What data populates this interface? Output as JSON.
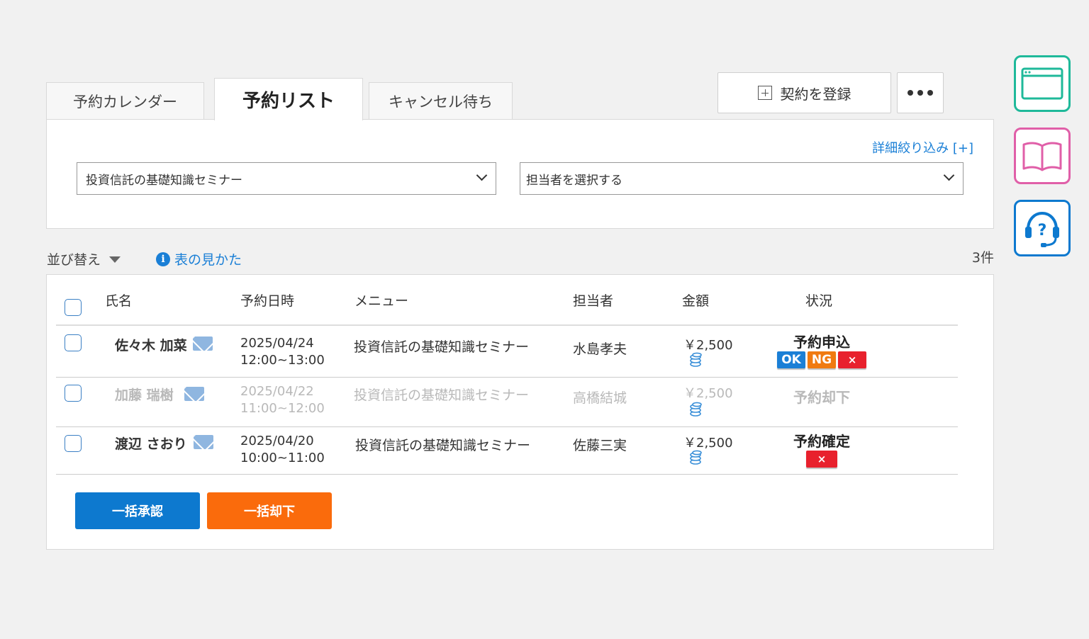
{
  "tabs": [
    {
      "label": "予約カレンダー"
    },
    {
      "label": "予約リスト"
    },
    {
      "label": "キャンセル待ち"
    }
  ],
  "actions": {
    "register_label": "契約を登録",
    "more_icon": "more-icon"
  },
  "filter": {
    "detail_link": "詳細絞り込み [+]",
    "menu_select_value": "投資信託の基礎知識セミナー",
    "staff_select_value": "担当者を選択する"
  },
  "list_bar": {
    "sort_label": "並び替え",
    "help_label": "表の見かた",
    "info_glyph": "i",
    "count": "3件"
  },
  "table": {
    "headers": {
      "name": "氏名",
      "datetime": "予約日時",
      "menu": "メニュー",
      "staff": "担当者",
      "amount": "金額",
      "status": "状況"
    },
    "rows": [
      {
        "name": "佐々木 加菜",
        "date": "2025/04/24",
        "time": "12:00~13:00",
        "menu": "投資信託の基礎知識セミナー",
        "staff": "水島孝夫",
        "amount": "￥2,500",
        "status": "予約申込",
        "actions": {
          "ok": "OK",
          "ng": "NG",
          "cancel": "×"
        }
      },
      {
        "name": "加藤 瑞樹",
        "date": "2025/04/22",
        "time": "11:00~12:00",
        "menu": "投資信託の基礎知識セミナー",
        "staff": "高橋結城",
        "amount": "￥2,500",
        "status": "予約却下"
      },
      {
        "name": "渡辺 さおり",
        "date": "2025/04/20",
        "time": "10:00~11:00",
        "menu": "投資信託の基礎知識セミナー",
        "staff": "佐藤三実",
        "amount": "￥2,500",
        "status": "予約確定",
        "actions": {
          "cancel": "×"
        }
      }
    ]
  },
  "bulk": {
    "approve_label": "一括承認",
    "reject_label": "一括却下"
  },
  "sidebar_icons": [
    "browser-window-icon",
    "book-icon",
    "support-headset-icon"
  ],
  "colors": {
    "link": "#1a7fd6",
    "approve": "#0d79cf",
    "reject": "#fa6b0c",
    "ok": "#1a7fd6",
    "ng": "#f07a10",
    "cancel": "#e8212d",
    "side_green": "#1fb99a",
    "side_pink": "#e05fa8",
    "side_blue": "#0d79cf"
  }
}
